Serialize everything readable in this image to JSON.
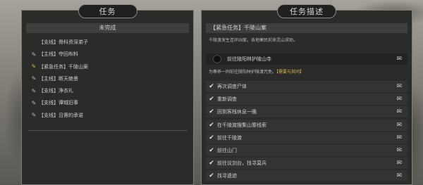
{
  "left_panel": {
    "title": "任务",
    "subheading": "未完成",
    "quests": [
      {
        "label": "【支线】骨科资深弟子",
        "icon": "none"
      },
      {
        "label": "【主线】夺回布料",
        "icon": "scroll-icon"
      },
      {
        "label": "【紧急任务】千陵山案",
        "icon": "urgent-scroll-icon"
      },
      {
        "label": "【主线】断天绝景",
        "icon": "scroll-icon"
      },
      {
        "label": "【支线】净衣礼",
        "icon": "scroll-icon"
      },
      {
        "label": "【支线】谭城旧事",
        "icon": "scroll-icon"
      },
      {
        "label": "【支线】且需的承诺",
        "icon": "scroll-icon"
      }
    ]
  },
  "right_panel": {
    "title": "任务描述",
    "task_name": "【紧急任务】千陵山案",
    "description_line1": "千陵渡发生连环凶案，各地寒民前来灵山求助。",
    "current_step": "前往陵阳林护陵山寺",
    "description_line2_prefix": "为寨养一同前往陵阳林护陵渡咒免。",
    "description_line2_hint": "【需要与其同】",
    "steps": [
      "再次调查尸体",
      "重新调查",
      "回到客栈休息一晚",
      "在千陵渡搜集山寨线索",
      "前往千陵渡",
      "前往山门",
      "前往议剑台，找寻莫兵",
      "找寻遗迹"
    ],
    "map_icon": "map-icon",
    "step_icon": "scroll-icon"
  },
  "colors": {
    "panel_bg": "#2b2b2a",
    "border": "#7f7d77",
    "text": "#d0cec8",
    "hint": "#d8b644"
  }
}
